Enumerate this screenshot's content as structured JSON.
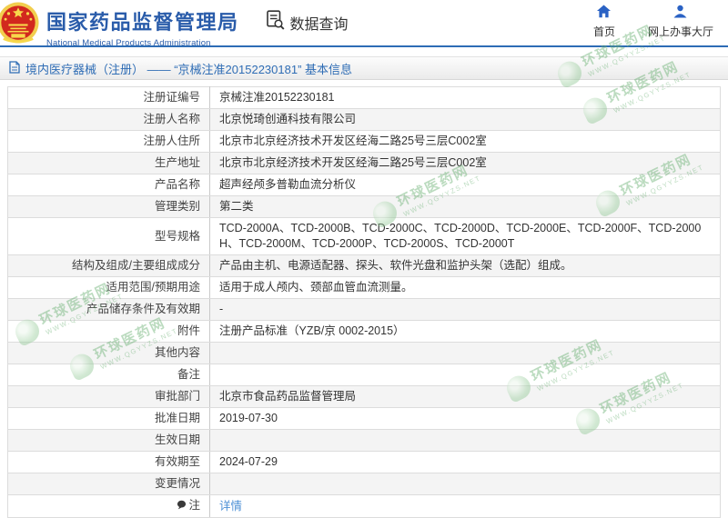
{
  "header": {
    "title": "国家药品监督管理局",
    "subtitle": "National Medical Products Administration",
    "query_label": "数据查询",
    "nav": [
      {
        "label": "首页",
        "icon": "home-icon"
      },
      {
        "label": "网上办事大厅",
        "icon": "person-icon"
      }
    ]
  },
  "breadcrumb": {
    "text": "境内医疗器械（注册） ——  “京械注准20152230181” 基本信息"
  },
  "table": {
    "rows": [
      {
        "label": "注册证编号",
        "value": "京械注准20152230181"
      },
      {
        "label": "注册人名称",
        "value": "北京悦琦创通科技有限公司"
      },
      {
        "label": "注册人住所",
        "value": "北京市北京经济技术开发区经海二路25号三层C002室"
      },
      {
        "label": "生产地址",
        "value": "北京市北京经济技术开发区经海二路25号三层C002室"
      },
      {
        "label": "产品名称",
        "value": "超声经颅多普勒血流分析仪"
      },
      {
        "label": "管理类别",
        "value": "第二类"
      },
      {
        "label": "型号规格",
        "value": "TCD-2000A、TCD-2000B、TCD-2000C、TCD-2000D、TCD-2000E、TCD-2000F、TCD-2000H、TCD-2000M、TCD-2000P、TCD-2000S、TCD-2000T"
      },
      {
        "label": "结构及组成/主要组成成分",
        "value": "产品由主机、电源适配器、探头、软件光盘和监护头架（选配）组成。"
      },
      {
        "label": "适用范围/预期用途",
        "value": "适用于成人颅内、颈部血管血流测量。"
      },
      {
        "label": "产品储存条件及有效期",
        "value": "-"
      },
      {
        "label": "附件",
        "value": "注册产品标准（YZB/京 0002-2015）"
      },
      {
        "label": "其他内容",
        "value": ""
      },
      {
        "label": "备注",
        "value": ""
      },
      {
        "label": "审批部门",
        "value": "北京市食品药品监督管理局"
      },
      {
        "label": "批准日期",
        "value": "2019-07-30"
      },
      {
        "label": "生效日期",
        "value": ""
      },
      {
        "label": "有效期至",
        "value": "2024-07-29"
      },
      {
        "label": "变更情况",
        "value": ""
      },
      {
        "label": "注",
        "value": "详情",
        "value_is_link": true,
        "label_icon": "comment-icon"
      }
    ]
  },
  "watermark": {
    "name": "环球医药网",
    "url": "www.qgyyzs.net"
  },
  "colors": {
    "accent_blue": "#2a5caa",
    "line_blue": "#2d6cb5",
    "link_blue": "#4b8fd5",
    "row_alt_gray": "#f4f4f4",
    "watermark_green": "#8cc492"
  }
}
